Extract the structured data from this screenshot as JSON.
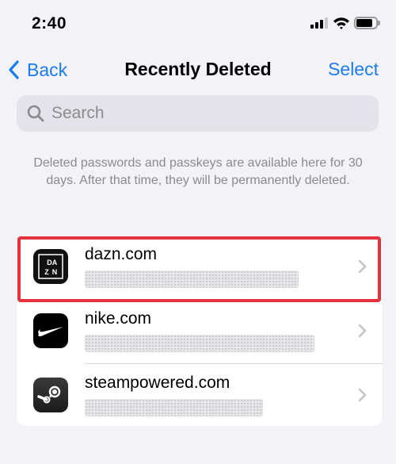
{
  "status_bar": {
    "time": "2:40"
  },
  "nav": {
    "back_label": "Back",
    "title": "Recently Deleted",
    "select_label": "Select"
  },
  "search": {
    "placeholder": "Search"
  },
  "info_text": "Deleted passwords and passkeys are available here for 30 days. After that time, they will be permanently deleted.",
  "items": [
    {
      "domain": "dazn.com",
      "icon": "dazn-logo-icon",
      "icon_text": [
        "D",
        "A",
        "Z",
        "N"
      ],
      "highlighted": true
    },
    {
      "domain": "nike.com",
      "icon": "nike-swoosh-icon"
    },
    {
      "domain": "steampowered.com",
      "icon": "steam-logo-icon"
    }
  ],
  "colors": {
    "accent": "#1c7cf0",
    "highlight": "#e5323f",
    "background": "#f2f2f7"
  }
}
